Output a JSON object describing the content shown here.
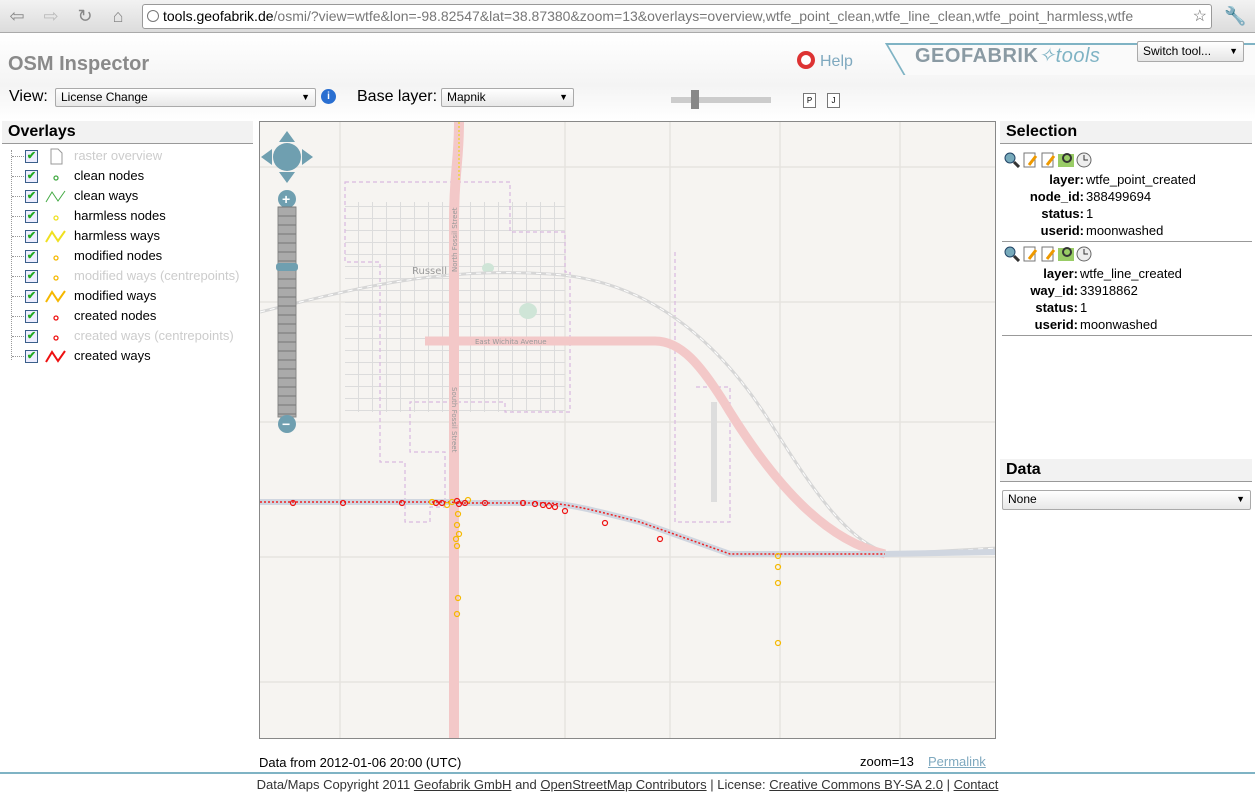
{
  "browser": {
    "url_host": "tools.geofabrik.de",
    "url_rest": "/osmi/?view=wtfe&lon=-98.82547&lat=38.87380&zoom=13&overlays=overview,wtfe_point_clean,wtfe_line_clean,wtfe_point_harmless,wtfe"
  },
  "header": {
    "title": "OSM Inspector",
    "help": "Help",
    "logo_main": "GEOFABRIK",
    "logo_sub": "tools",
    "switch_tool": "Switch tool...",
    "view_label": "View:",
    "view_value": "License Change",
    "base_label": "Base layer:",
    "base_value": "Mapnik"
  },
  "overlays": {
    "title": "Overlays",
    "items": [
      {
        "label": "raster overview",
        "enabled": false,
        "symbol": "page",
        "color": "#999999"
      },
      {
        "label": "clean nodes",
        "enabled": true,
        "symbol": "node",
        "color": "#44aa44"
      },
      {
        "label": "clean ways",
        "enabled": true,
        "symbol": "way",
        "color": "#44aa44"
      },
      {
        "label": "harmless nodes",
        "enabled": true,
        "symbol": "node",
        "color": "#f0e020"
      },
      {
        "label": "harmless ways",
        "enabled": true,
        "symbol": "way",
        "color": "#f0e020"
      },
      {
        "label": "modified nodes",
        "enabled": true,
        "symbol": "node",
        "color": "#f5b800"
      },
      {
        "label": "modified ways (centrepoints)",
        "enabled": false,
        "symbol": "node",
        "color": "#f5b800"
      },
      {
        "label": "modified ways",
        "enabled": true,
        "symbol": "way",
        "color": "#f5b800"
      },
      {
        "label": "created nodes",
        "enabled": true,
        "symbol": "node",
        "color": "#ee1111"
      },
      {
        "label": "created ways (centrepoints)",
        "enabled": false,
        "symbol": "node",
        "color": "#ee1111"
      },
      {
        "label": "created ways",
        "enabled": true,
        "symbol": "way",
        "color": "#ee1111"
      }
    ]
  },
  "map": {
    "labels": {
      "town": "Russell",
      "avenue": "East Wichita Avenue",
      "north_street": "North Fossil Street",
      "south_street": "South Fossil Street"
    }
  },
  "selection": {
    "title": "Selection",
    "blocks": [
      {
        "rows": [
          {
            "k": "layer:",
            "v": "wtfe_point_created"
          },
          {
            "k": "node_id:",
            "v": "388499694"
          },
          {
            "k": "status:",
            "v": "1"
          },
          {
            "k": "userid:",
            "v": "moonwashed"
          }
        ]
      },
      {
        "rows": [
          {
            "k": "layer:",
            "v": "wtfe_line_created"
          },
          {
            "k": "way_id:",
            "v": "33918862"
          },
          {
            "k": "status:",
            "v": "1"
          },
          {
            "k": "userid:",
            "v": "moonwashed"
          }
        ]
      }
    ]
  },
  "data_panel": {
    "title": "Data",
    "value": "None"
  },
  "status": {
    "data_from": "Data from 2012-01-06 20:00 (UTC)",
    "zoom": "zoom=13",
    "permalink": "Permalink"
  },
  "footer": {
    "prefix": "Data/Maps Copyright 2011",
    "geofabrik": "Geofabrik GmbH",
    "and": "and",
    "osm": "OpenStreetMap Contributors",
    "license_label": "| License:",
    "license": "Creative Commons BY-SA 2.0",
    "sep": "|",
    "contact": "Contact"
  }
}
